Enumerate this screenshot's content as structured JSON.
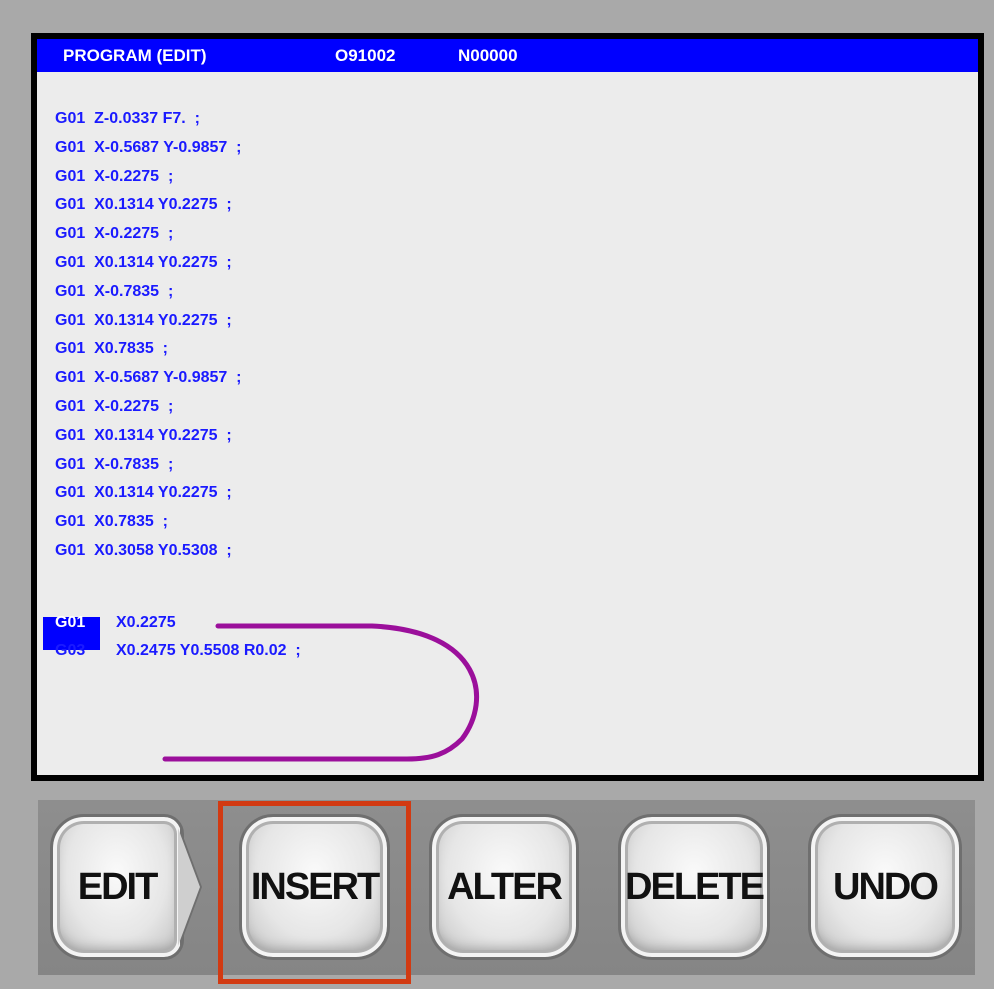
{
  "header": {
    "mode": "PROGRAM  (EDIT)",
    "program_number": "O91002",
    "sequence_number": "N00000"
  },
  "program": {
    "lines": [
      "G01  Z-0.0337 F7.  ;",
      "G01  X-0.5687 Y-0.9857  ;",
      "G01  X-0.2275  ;",
      "G01  X0.1314 Y0.2275  ;",
      "G01  X-0.2275  ;",
      "G01  X0.1314 Y0.2275  ;",
      "G01  X-0.7835  ;",
      "G01  X0.1314 Y0.2275  ;",
      "G01  X0.7835  ;",
      "G01  X-0.5687 Y-0.9857  ;",
      "G01  X-0.2275  ;",
      "G01  X0.1314 Y0.2275  ;",
      "G01  X-0.7835  ;",
      "G01  X0.1314 Y0.2275  ;",
      "G01  X0.7835  ;",
      "G01  X0.3058 Y0.5308  ;"
    ],
    "cursor_line_word": "G01",
    "cursor_line_rest": "X0.2275",
    "next_line_word": "G03",
    "next_line_rest": "X0.2475 Y0.5508 R0.02  ;"
  },
  "softkeys": {
    "edit": "EDIT",
    "insert": "INSERT",
    "alter": "ALTER",
    "delete": "DELETE",
    "undo": "UNDO"
  },
  "colors": {
    "title_bar": "#0000ff",
    "program_text": "#1a1aff",
    "selection_frame": "#d23a12",
    "tool_path": "#9b0f9b"
  }
}
